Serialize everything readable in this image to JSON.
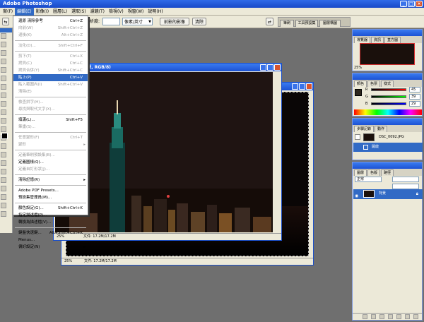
{
  "app": {
    "title": "Adobe Photoshop"
  },
  "colors": {
    "xp_blue": "#1c52d4",
    "menu_highlight": "#316ac5",
    "chrome": "#ece9d8",
    "workspace": "#6f6f6f"
  },
  "menubar": {
    "items": [
      "案(F)",
      "編輯(E)",
      "影像(I)",
      "圖層(L)",
      "選取(S)",
      "濾鏡(T)",
      "檢視(V)",
      "視窗(W)",
      "說明(H)"
    ],
    "active_index": 1
  },
  "options": {
    "field_label": "解析度:",
    "dropdown_value": "像素/英寸",
    "front_image_button": "前影的影像",
    "clear_button": "清除"
  },
  "palette_well": {
    "tabs": [
      "筆刷",
      "工具預設集",
      "圖層構圖"
    ]
  },
  "edit_menu": {
    "items": [
      {
        "label": "還原 清除參考",
        "shortcut": "Ctrl+Z",
        "disabled": false
      },
      {
        "label": "向前(W)",
        "shortcut": "Shift+Ctrl+Z",
        "disabled": true
      },
      {
        "label": "退後(K)",
        "shortcut": "Alt+Ctrl+Z",
        "disabled": true
      },
      {
        "sep": true
      },
      {
        "label": "淡化(D)...",
        "shortcut": "Shift+Ctrl+F",
        "disabled": true
      },
      {
        "sep": true
      },
      {
        "label": "剪下(T)",
        "shortcut": "Ctrl+X",
        "disabled": true
      },
      {
        "label": "拷貝(C)",
        "shortcut": "Ctrl+C",
        "disabled": true
      },
      {
        "label": "拷貝合併(Y)",
        "shortcut": "Shift+Ctrl+C",
        "disabled": true
      },
      {
        "label": "貼上(P)",
        "shortcut": "Ctrl+V",
        "disabled": false,
        "highlight": true
      },
      {
        "label": "貼入範圍內(I)",
        "shortcut": "Shift+Ctrl+V",
        "disabled": true
      },
      {
        "label": "清除(E)",
        "shortcut": "",
        "disabled": true
      },
      {
        "sep": true
      },
      {
        "label": "檢查拼字(H)...",
        "shortcut": "",
        "disabled": true
      },
      {
        "label": "尋找與取代文字(X)...",
        "shortcut": "",
        "disabled": true
      },
      {
        "sep": true
      },
      {
        "label": "填滿(L)...",
        "shortcut": "Shift+F5",
        "disabled": false
      },
      {
        "label": "筆畫(S)...",
        "shortcut": "",
        "disabled": true
      },
      {
        "sep": true
      },
      {
        "label": "任意變形(F)",
        "shortcut": "Ctrl+T",
        "disabled": true
      },
      {
        "label": "變形",
        "shortcut": "",
        "disabled": true,
        "submenu": true
      },
      {
        "sep": true
      },
      {
        "label": "定義筆刷預設集(B)...",
        "shortcut": "",
        "disabled": true
      },
      {
        "label": "定義圖樣(Q)...",
        "shortcut": "",
        "disabled": false
      },
      {
        "label": "定義自訂形狀(J)...",
        "shortcut": "",
        "disabled": true
      },
      {
        "sep": true
      },
      {
        "label": "清除記憶(R)",
        "shortcut": "",
        "disabled": false,
        "submenu": true
      },
      {
        "sep": true
      },
      {
        "label": "Adobe PDF Presets...",
        "shortcut": "",
        "disabled": false
      },
      {
        "label": "預設集管理員(M)...",
        "shortcut": "",
        "disabled": false
      },
      {
        "sep": true
      },
      {
        "label": "顏色設定(G)...",
        "shortcut": "Shift+Ctrl+K",
        "disabled": false
      },
      {
        "label": "指定描述檔(P)...",
        "shortcut": "",
        "disabled": false
      },
      {
        "label": "轉換為描述檔(V)...",
        "shortcut": "",
        "disabled": false
      },
      {
        "sep": true
      },
      {
        "label": "鍵盤快速鍵...",
        "shortcut": "Alt+Shift+Ctrl+K",
        "disabled": false
      },
      {
        "label": "Menus...",
        "shortcut": "",
        "disabled": false
      },
      {
        "label": "偏好設定(N)",
        "shortcut": "",
        "disabled": false,
        "submenu": true
      }
    ]
  },
  "doc_front": {
    "title": "@ 25% (背景, RGB/8)",
    "zoom": "25%",
    "doc_info": "文件: 17.2M/17.2M"
  },
  "doc_back": {
    "zoom": "25%",
    "doc_info": "文件: 17.2M/17.2M"
  },
  "navigator": {
    "tabs": [
      "導覽器",
      "資訊",
      "直方圖"
    ],
    "zoom": "25%"
  },
  "color_panel": {
    "tabs": [
      "顏色",
      "色票",
      "樣式"
    ],
    "r_label": "R",
    "g_label": "G",
    "b_label": "B",
    "r": "45",
    "g": "39",
    "b": "29"
  },
  "history_panel": {
    "tabs": [
      "步驟記錄",
      "動作"
    ],
    "snapshot": "DSC_0092.JPG",
    "step": "開啟"
  },
  "layers_panel": {
    "tabs": [
      "圖層",
      "色版",
      "路徑"
    ],
    "blend": "正常",
    "layer": "背景"
  }
}
